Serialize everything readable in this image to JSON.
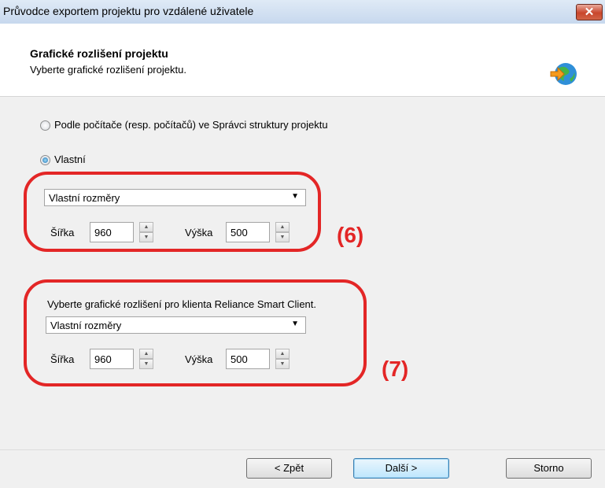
{
  "window": {
    "title": "Průvodce exportem projektu pro vzdálené uživatele",
    "close_icon": "close-icon"
  },
  "header": {
    "title": "Grafické rozlišení projektu",
    "subtitle": "Vyberte grafické rozlišení projektu.",
    "icon": "globe-arrow-icon"
  },
  "options": {
    "by_computer": {
      "label": "Podle počítače (resp. počítačů) ve Správci struktury projektu",
      "selected": false
    },
    "custom": {
      "label": "Vlastní",
      "selected": true
    }
  },
  "custom_section": {
    "combo_value": "Vlastní rozměry",
    "width_label": "Šířka",
    "width_value": "960",
    "height_label": "Výška",
    "height_value": "500"
  },
  "client_section": {
    "label": "Vyberte grafické rozlišení pro klienta Reliance Smart Client.",
    "combo_value": "Vlastní rozměry",
    "width_label": "Šířka",
    "width_value": "960",
    "height_label": "Výška",
    "height_value": "500"
  },
  "annotations": {
    "first": "(6)",
    "second": "(7)",
    "color": "#e32626"
  },
  "footer": {
    "back": "< Zpět",
    "next": "Další >",
    "cancel": "Storno"
  }
}
